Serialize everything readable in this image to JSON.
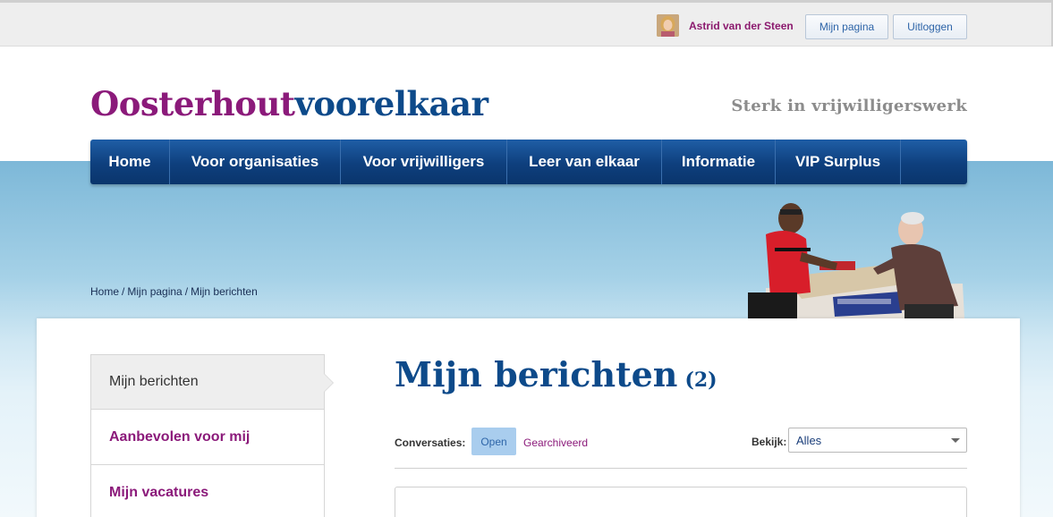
{
  "topbar": {
    "user_name": "Astrid van der Steen",
    "my_page_button": "Mijn pagina",
    "logout_button": "Uitloggen"
  },
  "header": {
    "logo_part1": "Oosterhout",
    "logo_part2": "voorelkaar",
    "tagline": "Sterk in vrijwilligerswerk"
  },
  "nav": {
    "items": [
      {
        "label": "Home"
      },
      {
        "label": "Voor organisaties"
      },
      {
        "label": "Voor vrijwilligers"
      },
      {
        "label": "Leer van elkaar"
      },
      {
        "label": "Informatie"
      },
      {
        "label": "VIP Surplus"
      }
    ]
  },
  "breadcrumb": {
    "items": [
      "Home",
      "Mijn pagina",
      "Mijn berichten"
    ],
    "separator": "/"
  },
  "sidebar": {
    "items": [
      {
        "label": "Mijn berichten",
        "active": true
      },
      {
        "label": "Aanbevolen voor mij"
      },
      {
        "label": "Mijn vacatures"
      }
    ]
  },
  "main": {
    "title": "Mijn berichten",
    "count": "(2)",
    "conversations_label": "Conversaties:",
    "tab_open": "Open",
    "tab_archived": "Gearchiveerd",
    "view_label": "Bekijk:",
    "view_selected": "Alles"
  },
  "colors": {
    "brand_purple": "#8b1a7a",
    "brand_blue": "#0d4a8a",
    "nav_blue": "#0e3f7d"
  }
}
